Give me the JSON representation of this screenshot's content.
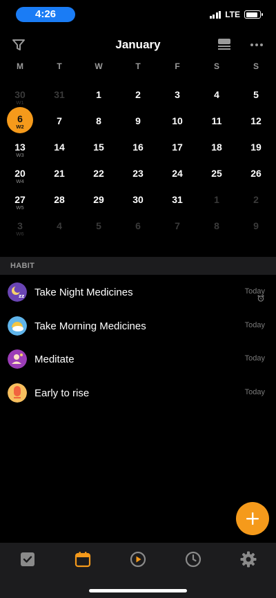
{
  "status_bar": {
    "time": "4:26",
    "network": "LTE",
    "battery_level": 0.85,
    "time_pill_color": "#1a7cf5"
  },
  "header": {
    "month_title": "January",
    "filter_icon": "filter-icon",
    "view_icon": "calendar-view-icon",
    "more_icon": "more-icon"
  },
  "weekdays": [
    "M",
    "T",
    "W",
    "T",
    "F",
    "S",
    "S"
  ],
  "calendar": {
    "weeks": [
      {
        "label": "W1",
        "days": [
          {
            "n": "30",
            "other": true
          },
          {
            "n": "31",
            "other": true
          },
          {
            "n": "1"
          },
          {
            "n": "2"
          },
          {
            "n": "3"
          },
          {
            "n": "4"
          },
          {
            "n": "5"
          }
        ]
      },
      {
        "label": "W2",
        "days": [
          {
            "n": "6",
            "today": true
          },
          {
            "n": "7"
          },
          {
            "n": "8"
          },
          {
            "n": "9"
          },
          {
            "n": "10"
          },
          {
            "n": "11"
          },
          {
            "n": "12"
          }
        ]
      },
      {
        "label": "W3",
        "days": [
          {
            "n": "13"
          },
          {
            "n": "14"
          },
          {
            "n": "15"
          },
          {
            "n": "16"
          },
          {
            "n": "17"
          },
          {
            "n": "18"
          },
          {
            "n": "19"
          }
        ]
      },
      {
        "label": "W4",
        "days": [
          {
            "n": "20"
          },
          {
            "n": "21"
          },
          {
            "n": "22"
          },
          {
            "n": "23"
          },
          {
            "n": "24"
          },
          {
            "n": "25"
          },
          {
            "n": "26"
          }
        ]
      },
      {
        "label": "W5",
        "days": [
          {
            "n": "27"
          },
          {
            "n": "28"
          },
          {
            "n": "29"
          },
          {
            "n": "30"
          },
          {
            "n": "31"
          },
          {
            "n": "1",
            "other": true
          },
          {
            "n": "2",
            "other": true
          }
        ]
      },
      {
        "label": "W6",
        "days": [
          {
            "n": "3",
            "other": true
          },
          {
            "n": "4",
            "other": true
          },
          {
            "n": "5",
            "other": true
          },
          {
            "n": "6",
            "other": true
          },
          {
            "n": "7",
            "other": true
          },
          {
            "n": "8",
            "other": true
          },
          {
            "n": "9",
            "other": true
          }
        ]
      }
    ],
    "today_color": "#f59a1b"
  },
  "habits": {
    "section_title": "HABIT",
    "items": [
      {
        "label": "Take Night Medicines",
        "time": "Today",
        "icon": "moon-sleep-icon",
        "alarm": true
      },
      {
        "label": "Take Morning Medicines",
        "time": "Today",
        "icon": "sun-cloud-icon",
        "alarm": false
      },
      {
        "label": "Meditate",
        "time": "Today",
        "icon": "meditate-icon",
        "alarm": false
      },
      {
        "label": "Early to rise",
        "time": "Today",
        "icon": "early-rise-icon",
        "alarm": false
      }
    ]
  },
  "fab": {
    "icon": "plus-icon",
    "color": "#f59a1b"
  },
  "bottom_nav": {
    "items": [
      {
        "icon": "task-checkbox-icon",
        "active": false
      },
      {
        "icon": "calendar-icon",
        "active": true
      },
      {
        "icon": "play-focus-icon",
        "active": false
      },
      {
        "icon": "clock-icon",
        "active": false
      },
      {
        "icon": "settings-gear-icon",
        "active": false
      }
    ],
    "accent_color": "#f59a1b"
  }
}
